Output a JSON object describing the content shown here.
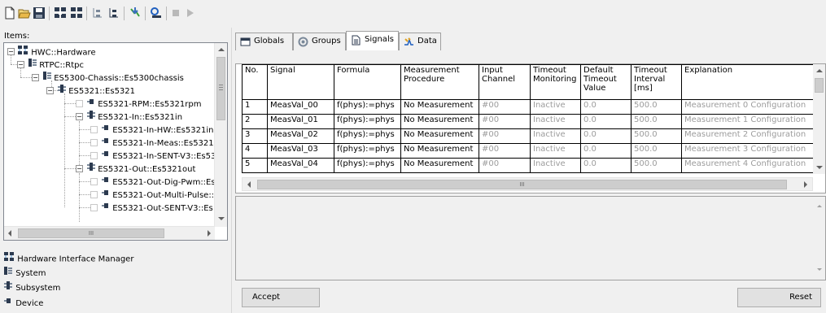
{
  "toolbar": {
    "buttons": [
      "new-icon",
      "open-icon",
      "save-icon",
      "hierarchy-add-icon",
      "hierarchy-remove-icon",
      "expand-all-icon",
      "collapse-all-icon",
      "download-icon",
      "search-icon",
      "stop-icon",
      "play-icon"
    ]
  },
  "left": {
    "items_label": "Items:",
    "tree": [
      {
        "label": "HWC::Hardware"
      },
      {
        "label": "RTPC::Rtpc"
      },
      {
        "label": "ES5300-Chassis::Es5300chassis"
      },
      {
        "label": "ES5321::Es5321"
      },
      {
        "label": "ES5321-RPM::Es5321rpm"
      },
      {
        "label": "ES5321-In::Es5321in"
      },
      {
        "label": "ES5321-In-HW::Es5321inl"
      },
      {
        "label": "ES5321-In-Meas::Es5321i"
      },
      {
        "label": "ES5321-In-SENT-V3::Es53"
      },
      {
        "label": "ES5321-Out::Es5321out"
      },
      {
        "label": "ES5321-Out-Dig-Pwm::Es"
      },
      {
        "label": "ES5321-Out-Multi-Pulse::E"
      },
      {
        "label": "ES5321-Out-SENT-V3::Es"
      }
    ],
    "hscroll_thumb": "III",
    "legend": [
      {
        "label": "Hardware Interface Manager",
        "icon": "hardware-interface-manager-icon"
      },
      {
        "label": "System",
        "icon": "system-icon"
      },
      {
        "label": "Subsystem",
        "icon": "subsystem-icon"
      },
      {
        "label": "Device",
        "icon": "device-icon"
      }
    ]
  },
  "tabs": [
    {
      "label": "Globals",
      "icon": "globals-icon"
    },
    {
      "label": "Groups",
      "icon": "groups-icon"
    },
    {
      "label": "Signals",
      "icon": "signals-icon",
      "active": true
    },
    {
      "label": "Data",
      "icon": "data-icon"
    }
  ],
  "grid": {
    "headers": [
      "No.",
      "Signal",
      "Formula",
      "Measurement Procedure",
      "Input Channel",
      "Timeout Monitoring",
      "Default Timeout Value",
      "Timeout Interval [ms]",
      "Explanation"
    ],
    "rows": [
      [
        "1",
        "MeasVal_00",
        "f(phys):=phys",
        "No Measurement",
        "#00",
        "Inactive",
        "0.0",
        "500.0",
        "Measurement 0 Configuration"
      ],
      [
        "2",
        "MeasVal_01",
        "f(phys):=phys",
        "No Measurement",
        "#00",
        "Inactive",
        "0.0",
        "500.0",
        "Measurement 1 Configuration"
      ],
      [
        "3",
        "MeasVal_02",
        "f(phys):=phys",
        "No Measurement",
        "#00",
        "Inactive",
        "0.0",
        "500.0",
        "Measurement 2 Configuration"
      ],
      [
        "4",
        "MeasVal_03",
        "f(phys):=phys",
        "No Measurement",
        "#00",
        "Inactive",
        "0.0",
        "500.0",
        "Measurement 3 Configuration"
      ],
      [
        "5",
        "MeasVal_04",
        "f(phys):=phys",
        "No Measurement",
        "#00",
        "Inactive",
        "0.0",
        "500.0",
        "Measurement 4 Configuration"
      ]
    ],
    "hscroll_thumb": "III"
  },
  "buttons": {
    "accept": "Accept",
    "reset": "Reset"
  },
  "colors": {
    "node_dark": "#3a4a5e",
    "grid_dim_text": "#9c9c9c",
    "accent_blue": "#1f5fbf"
  }
}
